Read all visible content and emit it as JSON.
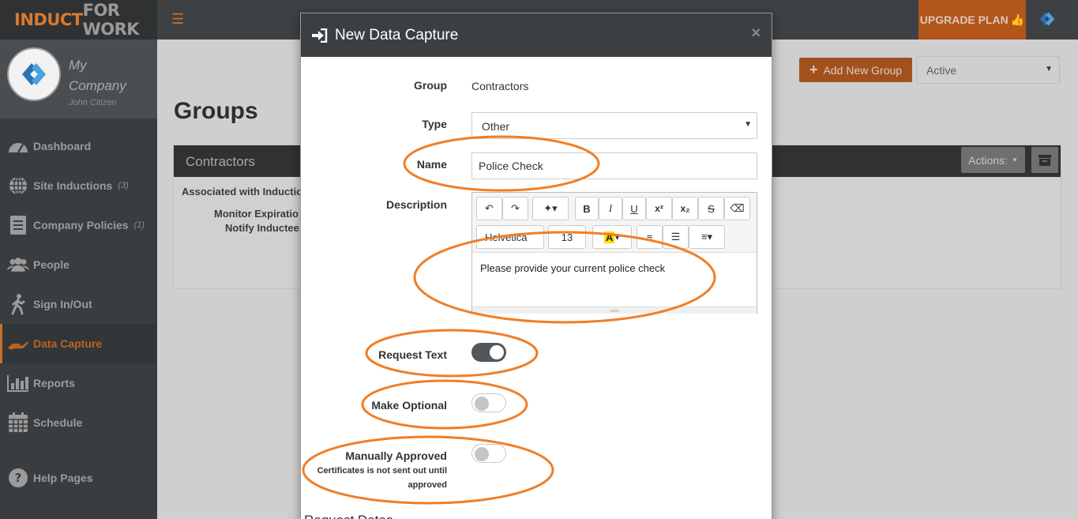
{
  "app": {
    "logo_part1": "INDUCT",
    "logo_part2": "FOR WORK",
    "company_name": "My Company",
    "user_name": "John Citizen",
    "upgrade_label": "UPGRADE PLAN"
  },
  "sidebar": {
    "items": [
      {
        "label": "Dashboard",
        "count": "",
        "icon": "dashboard-icon"
      },
      {
        "label": "Site Inductions",
        "count": "(3)",
        "icon": "globe-icon"
      },
      {
        "label": "Company Policies",
        "count": "(1)",
        "icon": "document-icon"
      },
      {
        "label": "People",
        "count": "",
        "icon": "people-icon"
      },
      {
        "label": "Sign In/Out",
        "count": "",
        "icon": "walking-icon"
      },
      {
        "label": "Data Capture",
        "count": "",
        "icon": "hand-icon"
      },
      {
        "label": "Reports",
        "count": "",
        "icon": "bar-chart-icon"
      },
      {
        "label": "Schedule",
        "count": "",
        "icon": "calendar-icon"
      },
      {
        "label": "Help Pages",
        "count": "",
        "icon": "help-icon"
      }
    ],
    "active_index": 5
  },
  "main": {
    "title": "Groups",
    "add_group_label": "Add New Group",
    "status_filter": "Active",
    "panel": {
      "title": "Contractors",
      "actions_label": "Actions:",
      "associated_label": "Associated with Inductio",
      "monitor_label": "Monitor Expiratio",
      "notify_label": "Notify Inductee"
    }
  },
  "modal": {
    "title": "New Data Capture",
    "group_label": "Group",
    "group_value": "Contractors",
    "type_label": "Type",
    "type_value": "Other",
    "name_label": "Name",
    "name_value": "Police Check",
    "description_label": "Description",
    "font_family": "Helvetica",
    "font_size": "13",
    "description_text": "Please provide your current police check",
    "request_text_label": "Request Text",
    "request_text_on": true,
    "make_optional_label": "Make Optional",
    "make_optional_on": false,
    "manual_approved_label": "Manually Approved",
    "manual_approved_on": false,
    "manual_approved_note": "Certificates is not sent out until approved",
    "next_section": "Request Dates"
  },
  "colors": {
    "accent": "#c8712c",
    "annotation": "#f07e26",
    "toggle_on": "#52575b"
  }
}
